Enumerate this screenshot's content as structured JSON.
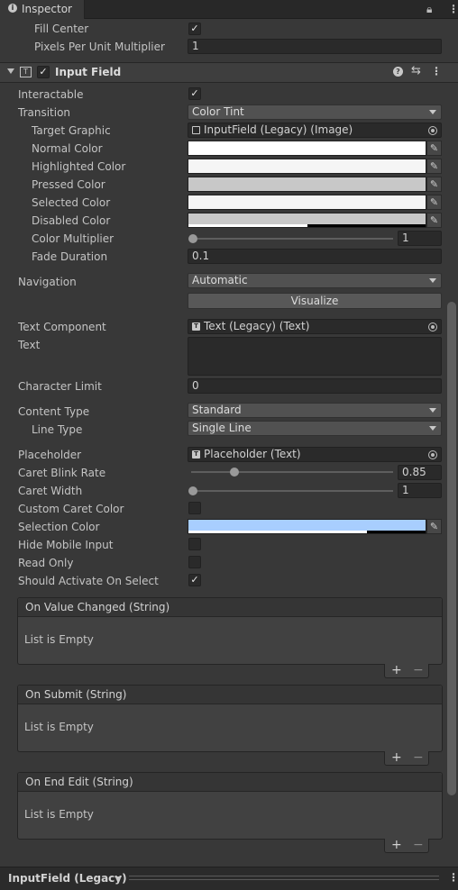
{
  "tab": {
    "title": "Inspector"
  },
  "image_section": {
    "fill_center_label": "Fill Center",
    "pixels_per_unit_label": "Pixels Per Unit Multiplier",
    "pixels_per_unit_value": "1"
  },
  "component": {
    "title": "Input Field"
  },
  "fields": {
    "interactable": "Interactable",
    "transition": "Transition",
    "transition_value": "Color Tint",
    "target_graphic": "Target Graphic",
    "target_graphic_value": "InputField (Legacy) (Image)",
    "normal_color": "Normal Color",
    "highlighted_color": "Highlighted Color",
    "pressed_color": "Pressed Color",
    "selected_color": "Selected Color",
    "disabled_color": "Disabled Color",
    "color_multiplier": "Color Multiplier",
    "color_multiplier_value": "1",
    "fade_duration": "Fade Duration",
    "fade_duration_value": "0.1",
    "navigation": "Navigation",
    "navigation_value": "Automatic",
    "visualize": "Visualize",
    "text_component": "Text Component",
    "text_component_value": "Text (Legacy) (Text)",
    "text": "Text",
    "character_limit": "Character Limit",
    "character_limit_value": "0",
    "content_type": "Content Type",
    "content_type_value": "Standard",
    "line_type": "Line Type",
    "line_type_value": "Single Line",
    "placeholder": "Placeholder",
    "placeholder_value": "Placeholder (Text)",
    "caret_blink_rate": "Caret Blink Rate",
    "caret_blink_rate_value": "0.85",
    "caret_width": "Caret Width",
    "caret_width_value": "1",
    "custom_caret_color": "Custom Caret Color",
    "selection_color": "Selection Color",
    "hide_mobile_input": "Hide Mobile Input",
    "read_only": "Read Only",
    "should_activate": "Should Activate On Select"
  },
  "colors": {
    "normal": "#ffffff",
    "highlighted": "#f5f5f5",
    "pressed": "#c8c8c8",
    "selected": "#f5f5f5",
    "disabled": "#c8c8c8",
    "selection": "#a8cefe"
  },
  "events": [
    {
      "title": "On Value Changed (String)",
      "body": "List is Empty",
      "add": "+",
      "remove": "−"
    },
    {
      "title": "On Submit (String)",
      "body": "List is Empty",
      "add": "+",
      "remove": "−"
    },
    {
      "title": "On End Edit (String)",
      "body": "List is Empty",
      "add": "+",
      "remove": "−"
    }
  ],
  "footer": {
    "label": "InputField (Legacy)"
  }
}
